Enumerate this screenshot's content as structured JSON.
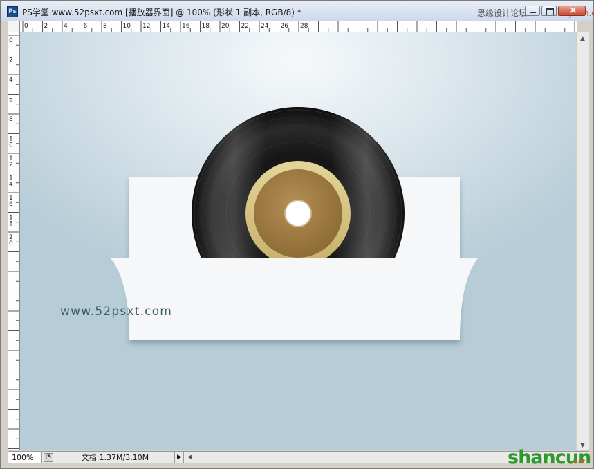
{
  "window": {
    "title": "PS学堂 www.52psxt.com [播放器界面] @ 100% (形状 1 副本, RGB/8) *",
    "app_icon": "Ps",
    "top_watermark_prefix": "思缘设计论坛",
    "top_watermark_suffix": "www.missyuan.com"
  },
  "rulers": {
    "horizontal_labels": [
      "0",
      "2",
      "4",
      "6",
      "8",
      "10",
      "12",
      "14",
      "16",
      "18",
      "20",
      "22",
      "24",
      "26",
      "28"
    ],
    "vertical_labels": [
      "0",
      "2",
      "4",
      "6",
      "8",
      "10",
      "12",
      "14",
      "16",
      "18",
      "20"
    ]
  },
  "canvas": {
    "website_text": "www.52psxt.com",
    "colors": {
      "background_light": "#f6f9fb",
      "background_dark": "#b6ccd7",
      "card": "#f6f7f8",
      "vinyl": "#111111",
      "label_gold": "#a9844a",
      "label_ring": "#d9c98d"
    }
  },
  "status": {
    "zoom": "100%",
    "doc_info": "文档:1.37M/3.10M"
  },
  "watermark": {
    "brand": "shancun",
    "suffix": ".net"
  }
}
